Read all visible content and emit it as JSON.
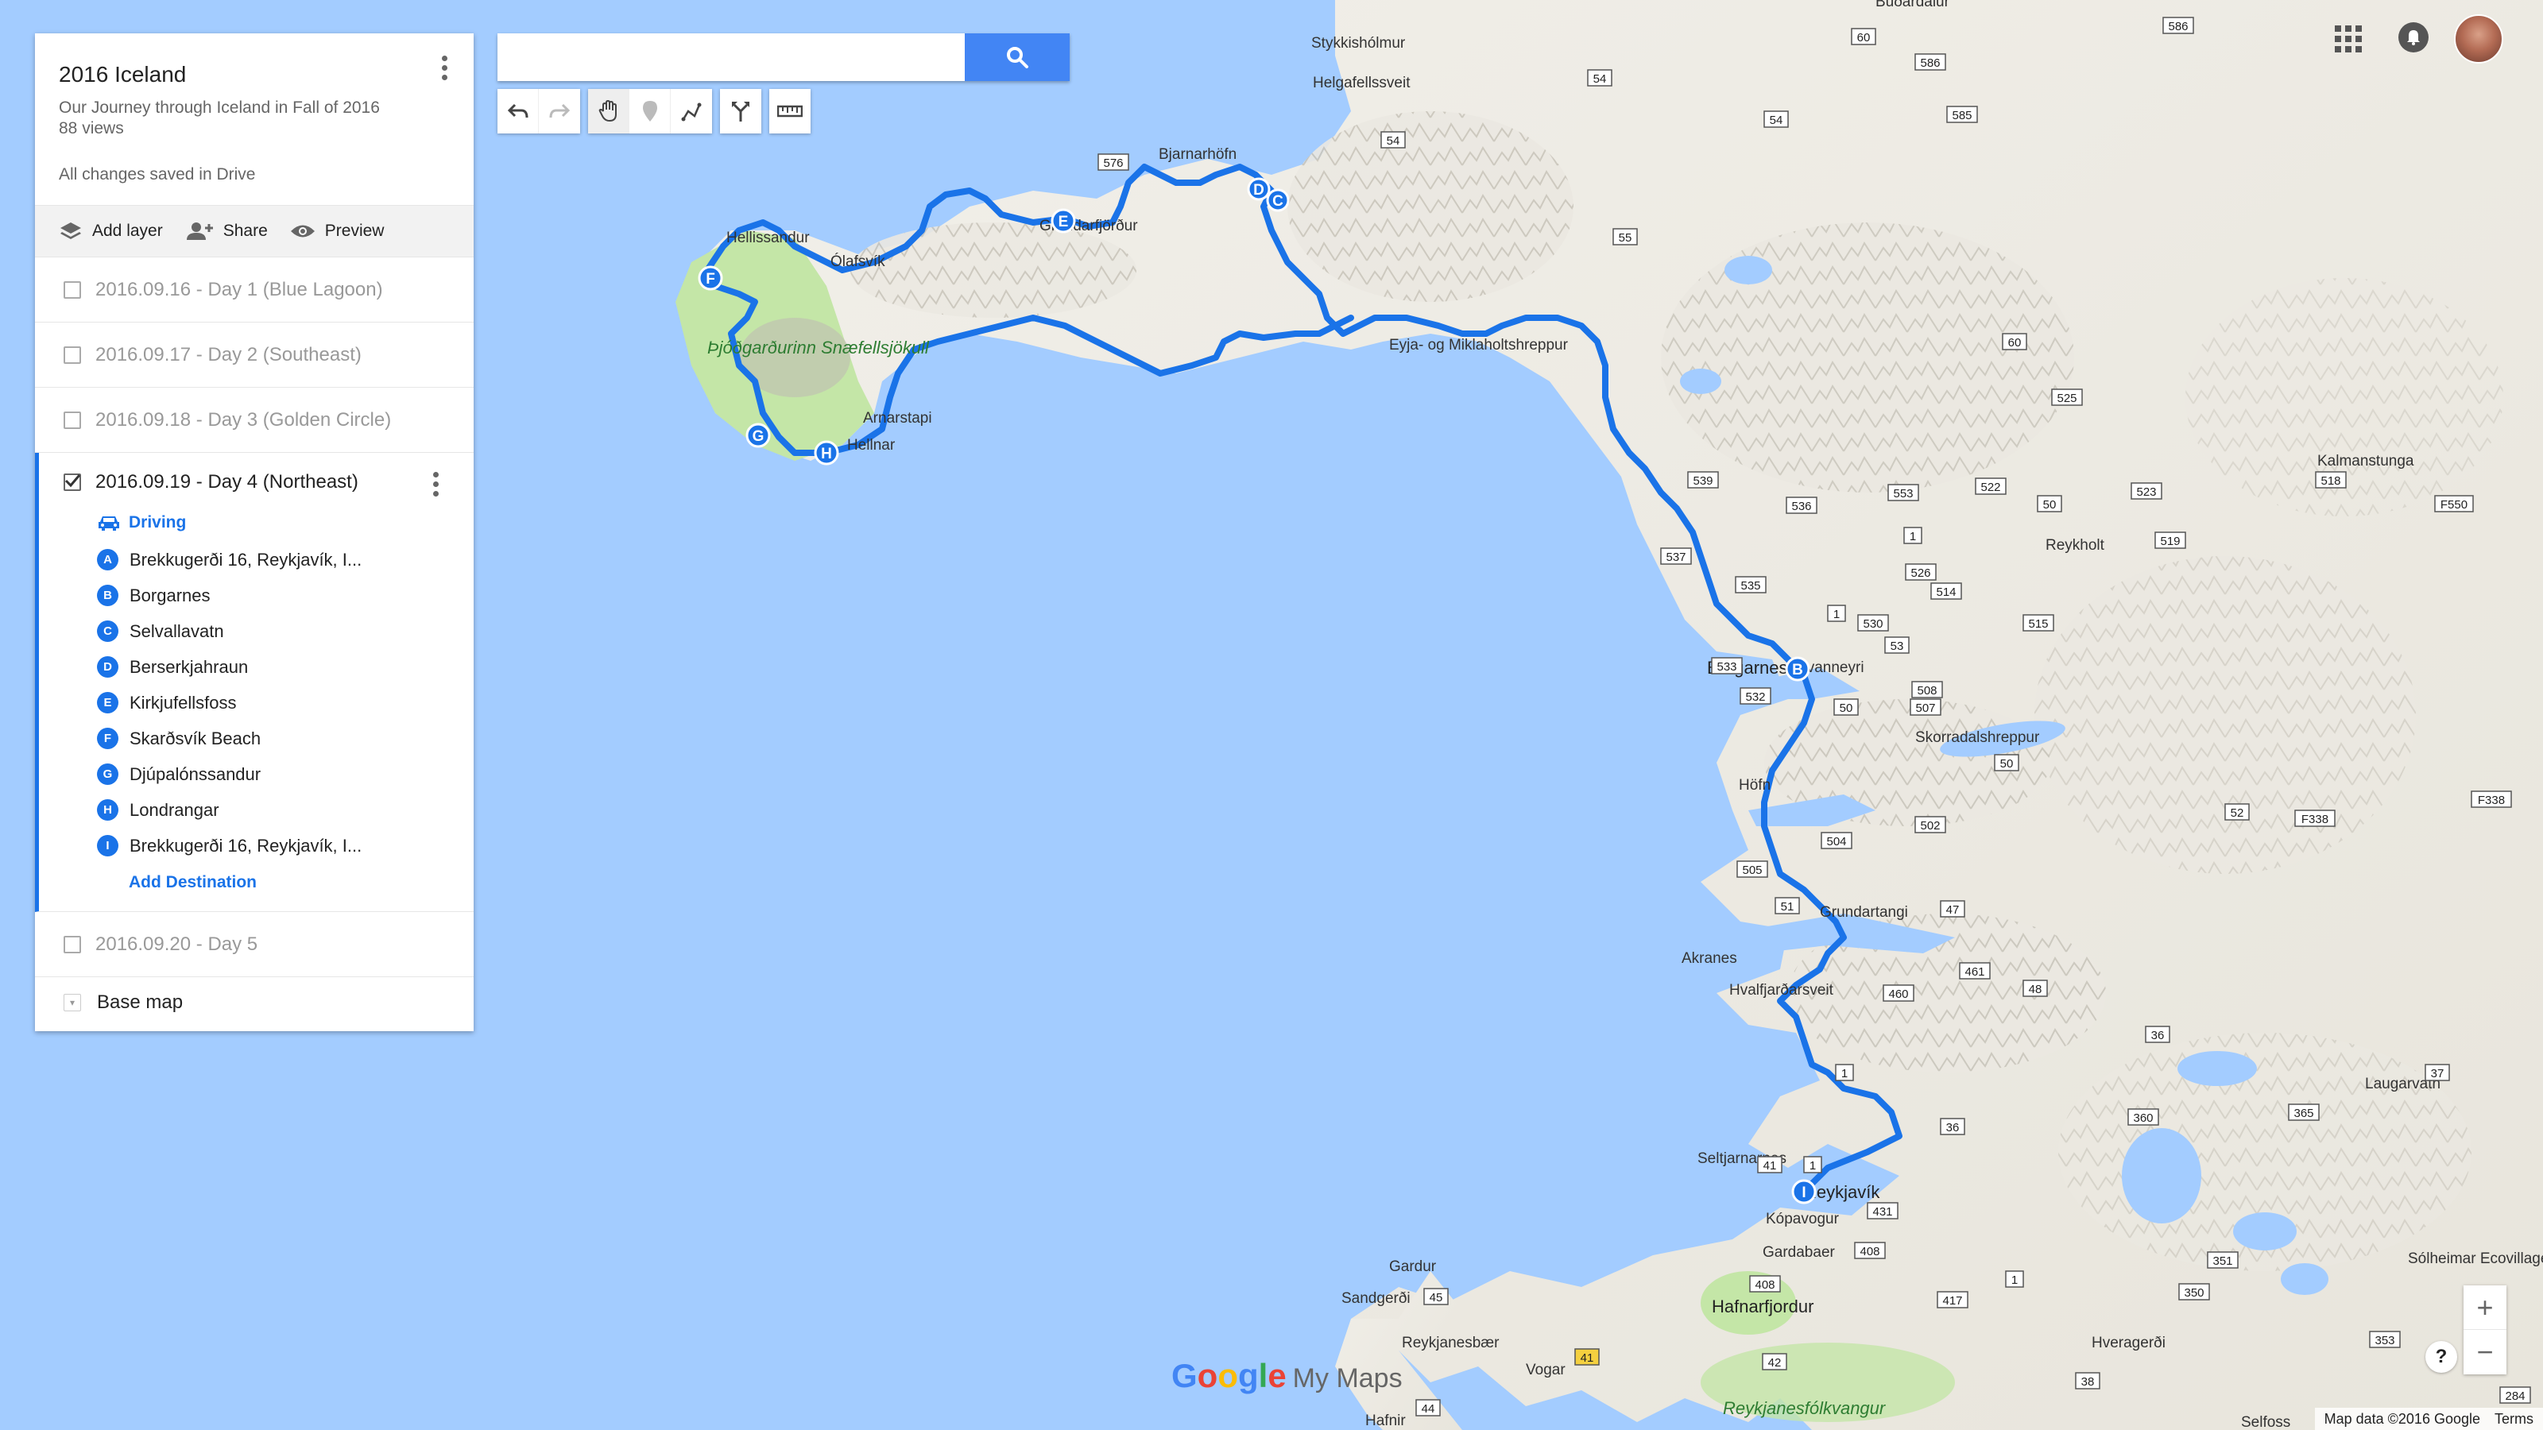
{
  "map": {
    "title": "2016 Iceland",
    "description": "Our Journey through Iceland in Fall of 2016",
    "views": "88 views",
    "save_status": "All changes saved in Drive"
  },
  "actions": {
    "add_layer": "Add layer",
    "share": "Share",
    "preview": "Preview"
  },
  "layers": [
    {
      "label": "2016.09.16 - Day 1 (Blue Lagoon)",
      "checked": false
    },
    {
      "label": "2016.09.17 - Day 2 (Southeast)",
      "checked": false
    },
    {
      "label": "2016.09.18 - Day 3 (Golden Circle)",
      "checked": false
    },
    {
      "label": "2016.09.19 - Day 4 (Northeast)",
      "checked": true
    },
    {
      "label": "2016.09.20 - Day 5",
      "checked": false
    }
  ],
  "active_layer": {
    "mode": "Driving",
    "destinations": [
      {
        "letter": "A",
        "name": "Brekkugerði 16, Reykjavík, I..."
      },
      {
        "letter": "B",
        "name": "Borgarnes"
      },
      {
        "letter": "C",
        "name": "Selvallavatn"
      },
      {
        "letter": "D",
        "name": "Berserkjahraun"
      },
      {
        "letter": "E",
        "name": "Kirkjufellsfoss"
      },
      {
        "letter": "F",
        "name": "Skarðsvík Beach"
      },
      {
        "letter": "G",
        "name": "Djúpalónssandur"
      },
      {
        "letter": "H",
        "name": "Londrangar"
      },
      {
        "letter": "I",
        "name": "Brekkugerði 16, Reykjavík, I..."
      }
    ],
    "add_destination": "Add Destination"
  },
  "base_map": "Base map",
  "search": {
    "placeholder": ""
  },
  "place_labels": {
    "stykkisholmur": "Stykkishólmur",
    "helgafellssveit": "Helgafellssveit",
    "bjarnarhofn": "Bjarnarhöfn",
    "grundarfjordur": "Grundarfjörður",
    "hellissandur": "Hellissandur",
    "olafsvik": "Ólafsvík",
    "snaefellsjokull_park": "Þjóðgarðurinn Snæfellsjökull",
    "arnarstapi": "Arnarstapi",
    "hellnar": "Hellnar",
    "eyja_og_miklaholtshreppur": "Eyja- og Miklaholtshreppur",
    "borgarnes": "Borgarnes",
    "hvanneyri": "Hvanneyri",
    "skorradalshreppur": "Skorradalshreppur",
    "reykholt": "Reykholt",
    "kalmanstunga": "Kalmanstunga",
    "hofn": "Höfn",
    "grundartangi": "Grundartangi",
    "akranes": "Akranes",
    "hvalfjardarsveit": "Hvalfjarðarsveit",
    "seltjarnarnes": "Seltjarnarnes",
    "reykjavik": "Reykjavík",
    "kopavogur": "Kópavogur",
    "gardabaer": "Gardabaer",
    "hafnarfjordur": "Hafnarfjordur",
    "gardur": "Gardur",
    "sandgerdi": "Sandgerði",
    "reykjanesbaer": "Reykjanesbær",
    "vogar": "Vogar",
    "hafnir": "Hafnir",
    "hveragerdi": "Hveragerði",
    "laugarvatn": "Laugarvatn",
    "solheimar": "Sólheimar Ecovillage",
    "reykjanesfolkvangur": "Reykjanesfólkvangur",
    "selfoss": "Selfoss",
    "budardalur": "Búðardalur"
  },
  "road_numbers": {
    "r60a": "60",
    "r586": "586",
    "r585": "585",
    "r54a": "54",
    "r54b": "54",
    "r54c": "54",
    "r576": "576",
    "r55": "55",
    "r60b": "60",
    "r525": "525",
    "r539": "539",
    "r536": "536",
    "r553": "553",
    "r522": "522",
    "r50a": "50",
    "r523": "523",
    "r518": "518",
    "rF550": "F550",
    "r537": "537",
    "r1a": "1",
    "r519": "519",
    "r526": "526",
    "r535": "535",
    "r514": "514",
    "r1b": "1",
    "r530": "530",
    "r515": "515",
    "r533": "533",
    "r53": "53",
    "r532": "532",
    "r508": "508",
    "r50b": "50",
    "r507": "507",
    "r50c": "50",
    "r52": "52",
    "rF338": "F338",
    "r502": "502",
    "r504": "504",
    "r505": "505",
    "r51": "51",
    "r47": "47",
    "r461": "461",
    "r48": "48",
    "r460": "460",
    "r1c": "1",
    "r36a": "36",
    "r37": "37",
    "r36b": "36",
    "r360": "360",
    "r365": "365",
    "r41a": "41",
    "r1d": "1",
    "r431": "431",
    "r408a": "408",
    "r408b": "408",
    "r417": "417",
    "r1e": "1",
    "r351": "351",
    "r350": "350",
    "r45": "45",
    "r41b": "41",
    "r42": "42",
    "r44": "44",
    "r38": "38",
    "r353": "353",
    "r284": "284"
  },
  "branding": {
    "g1": "G",
    "o1": "o",
    "o2": "o",
    "g2": "g",
    "l": "l",
    "e": "e",
    "suffix": "My Maps"
  },
  "attribution": {
    "map_data": "Map data ©2016 Google",
    "terms": "Terms"
  },
  "zoom": {
    "plus": "+",
    "minus": "−"
  },
  "help": "?",
  "colors": {
    "water": "#a3ccff",
    "route": "#1a73e8",
    "park": "#c4e6a7",
    "brand_blue": "#4285f4"
  }
}
